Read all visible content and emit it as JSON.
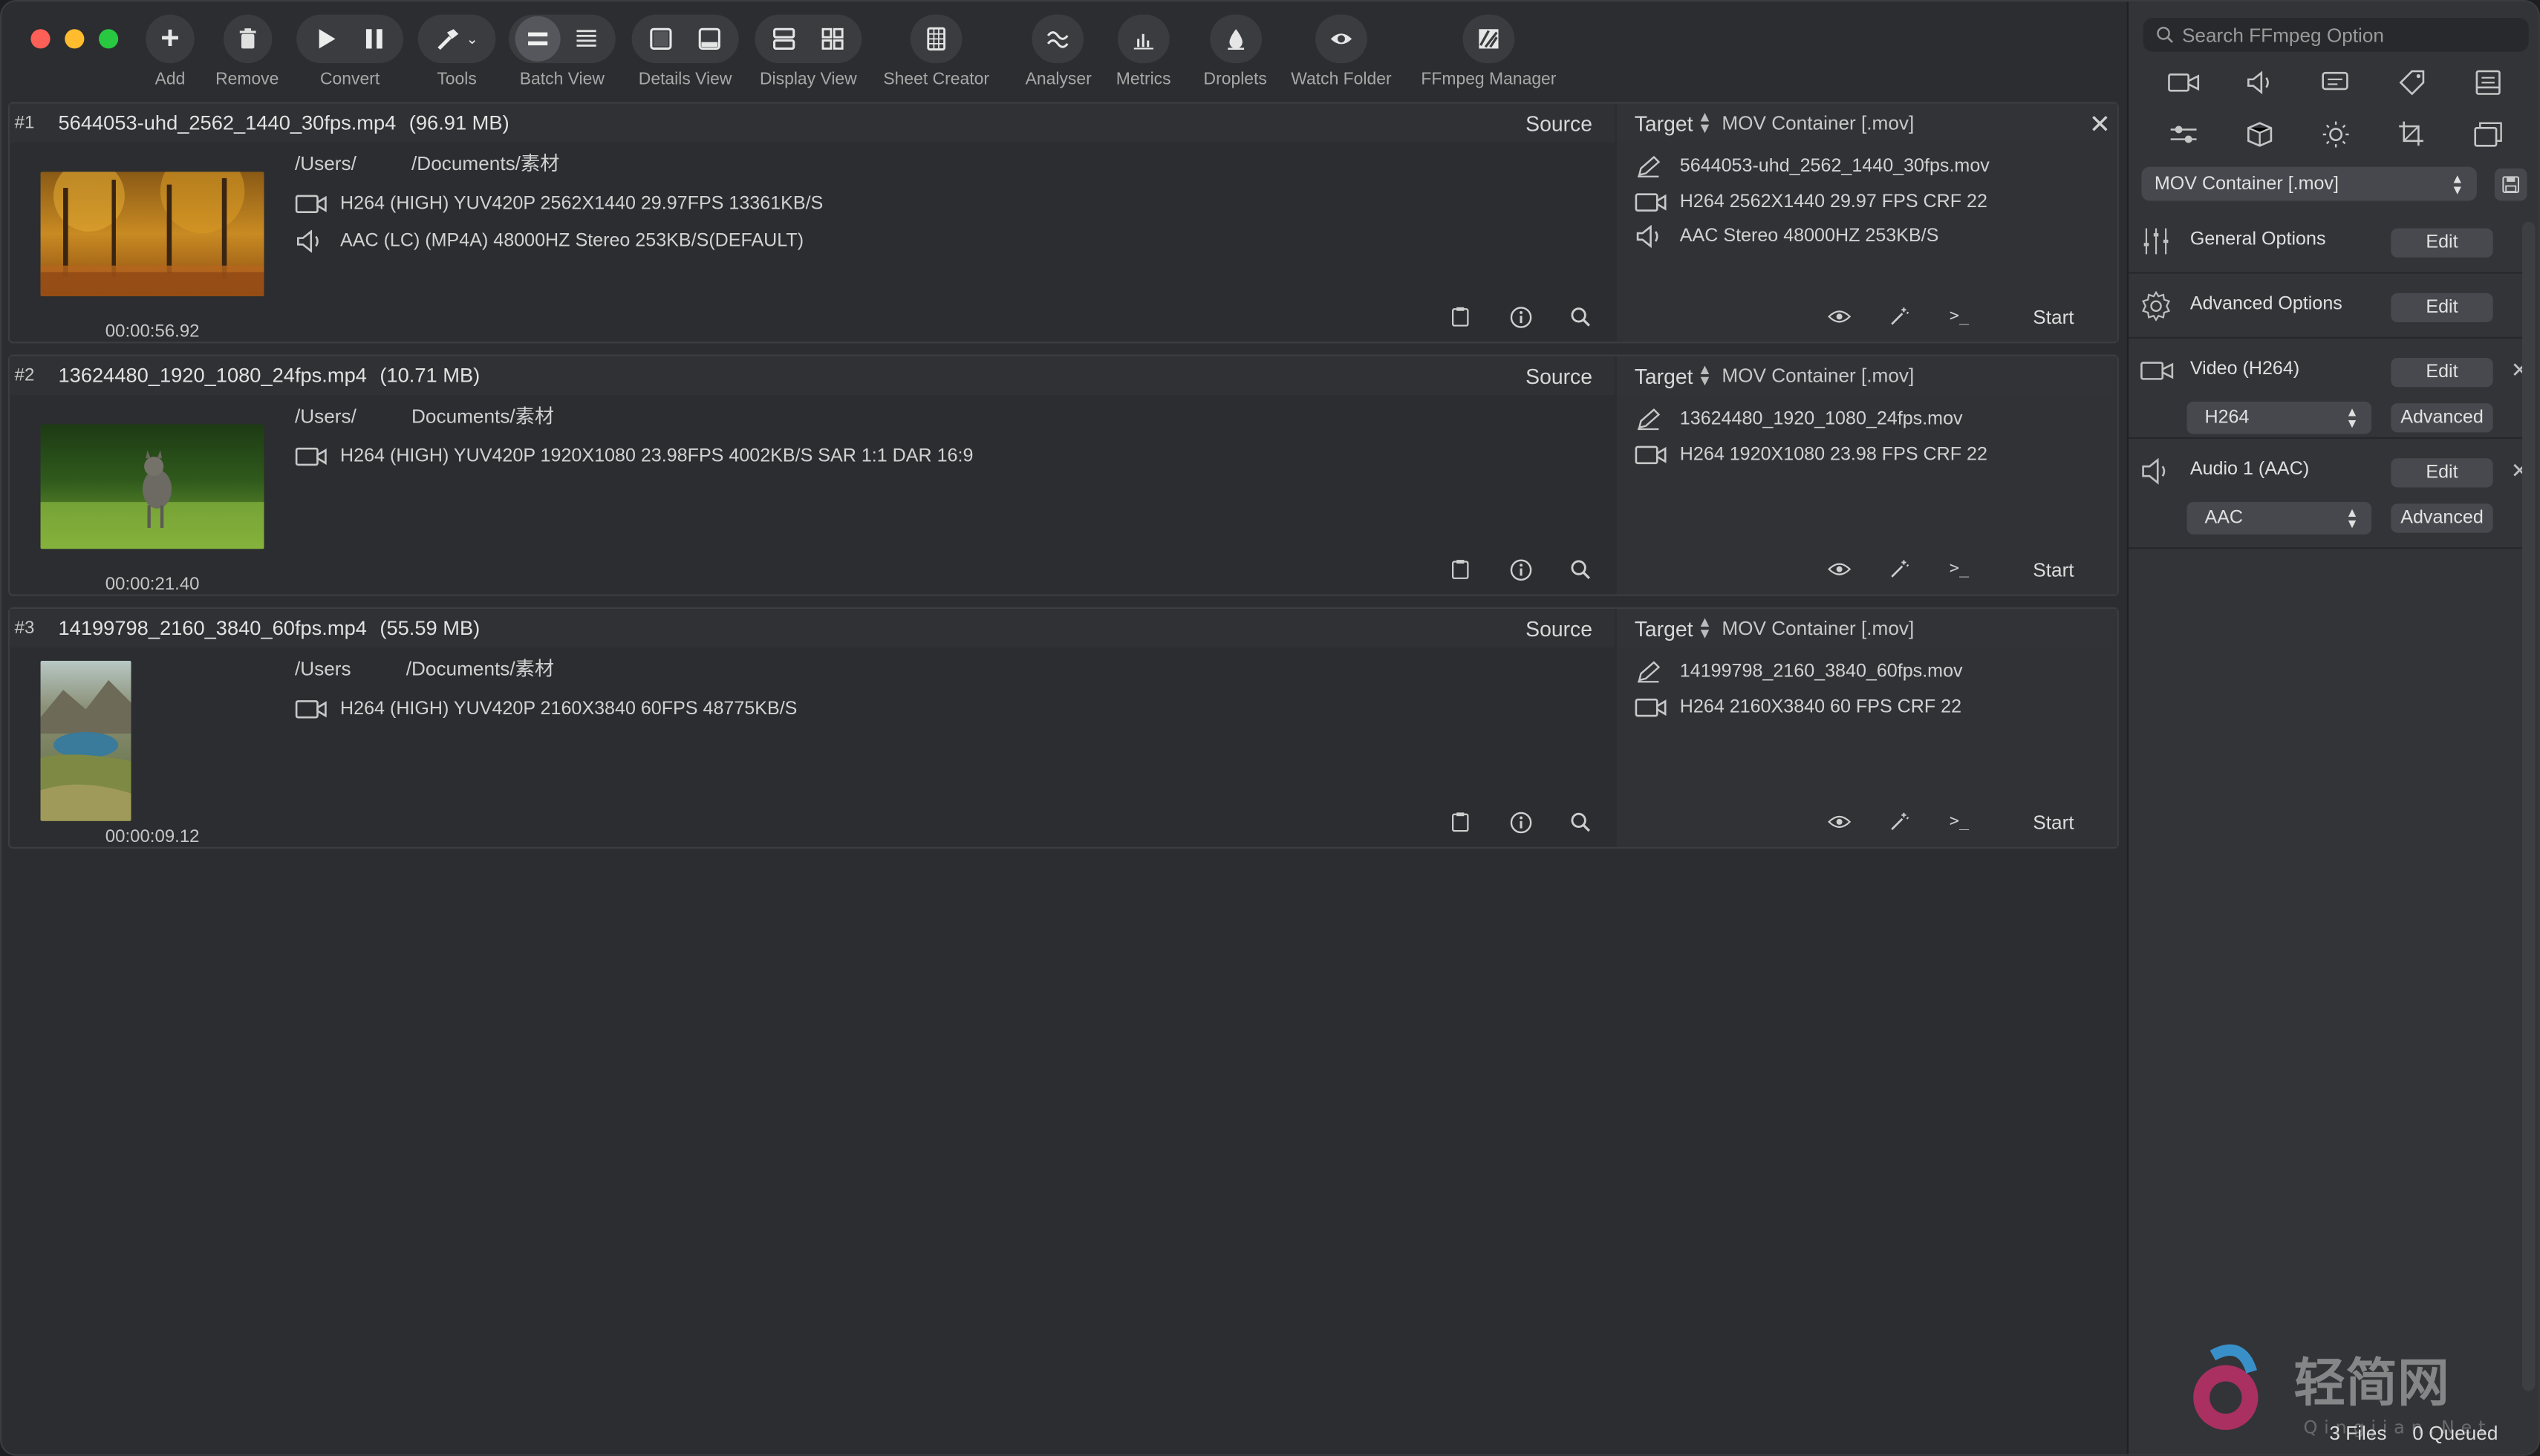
{
  "toolbar": {
    "add": "Add",
    "remove": "Remove",
    "convert": "Convert",
    "tools": "Tools",
    "batch_view": "Batch View",
    "details_view": "Details View",
    "display_view": "Display View",
    "sheet_creator": "Sheet Creator",
    "analyser": "Analyser",
    "metrics": "Metrics",
    "droplets": "Droplets",
    "watch_folder": "Watch Folder",
    "ffmpeg_manager": "FFmpeg Manager"
  },
  "labels": {
    "source": "Source",
    "target": "Target",
    "start": "Start"
  },
  "jobs": [
    {
      "index": "#1",
      "name": "5644053-uhd_2562_1440_30fps.mp4",
      "size": "(96.91 MB)",
      "path_a": "/Users/",
      "path_b": "/Documents/素材",
      "video": "H264 (HIGH) YUV420P 2562X1440  29.97FPS 13361KB/S",
      "audio": "AAC (LC) (MP4A) 48000HZ Stereo 253KB/S(DEFAULT)",
      "duration": "00:00:56.92",
      "target_container": "MOV Container [.mov]",
      "target_name": "5644053-uhd_2562_1440_30fps.mov",
      "target_video": "H264 2562X1440 29.97 FPS CRF 22",
      "target_audio": "AAC Stereo 48000HZ 253KB/S"
    },
    {
      "index": "#2",
      "name": "13624480_1920_1080_24fps.mp4",
      "size": "(10.71 MB)",
      "path_a": "/Users/",
      "path_b": "Documents/素材",
      "video": "H264 (HIGH) YUV420P 1920X1080  23.98FPS 4002KB/S SAR 1:1 DAR 16:9",
      "duration": "00:00:21.40",
      "target_container": "MOV Container [.mov]",
      "target_name": "13624480_1920_1080_24fps.mov",
      "target_video": "H264 1920X1080 23.98 FPS CRF 22"
    },
    {
      "index": "#3",
      "name": "14199798_2160_3840_60fps.mp4",
      "size": "(55.59 MB)",
      "path_a": "/Users",
      "path_b": "/Documents/素材",
      "video": "H264 (HIGH) YUV420P 2160X3840  60FPS 48775KB/S",
      "duration": "00:00:09.12",
      "target_container": "MOV Container [.mov]",
      "target_name": "14199798_2160_3840_60fps.mov",
      "target_video": "H264 2160X3840 60 FPS CRF 22"
    }
  ],
  "panel": {
    "search_placeholder": "Search FFmpeg Option",
    "container": "MOV Container [.mov]",
    "general_options": "General Options",
    "advanced_options": "Advanced Options",
    "video_stream": "Video (H264)",
    "audio_stream": "Audio 1 (AAC)",
    "edit": "Edit",
    "advanced": "Advanced",
    "video_codec": "H264",
    "audio_codec": "AAC"
  },
  "status": {
    "files": "3 Files",
    "queued": "0 Queued"
  },
  "watermark": {
    "text": "轻简网",
    "sub": "Qingjian.Net"
  },
  "colors": {
    "window_bg": "#2b2d30",
    "panel_bg": "#323438",
    "button_bg": "#48494e",
    "close": "#fe5f57",
    "minimize": "#febc2e",
    "zoom": "#28c840"
  }
}
